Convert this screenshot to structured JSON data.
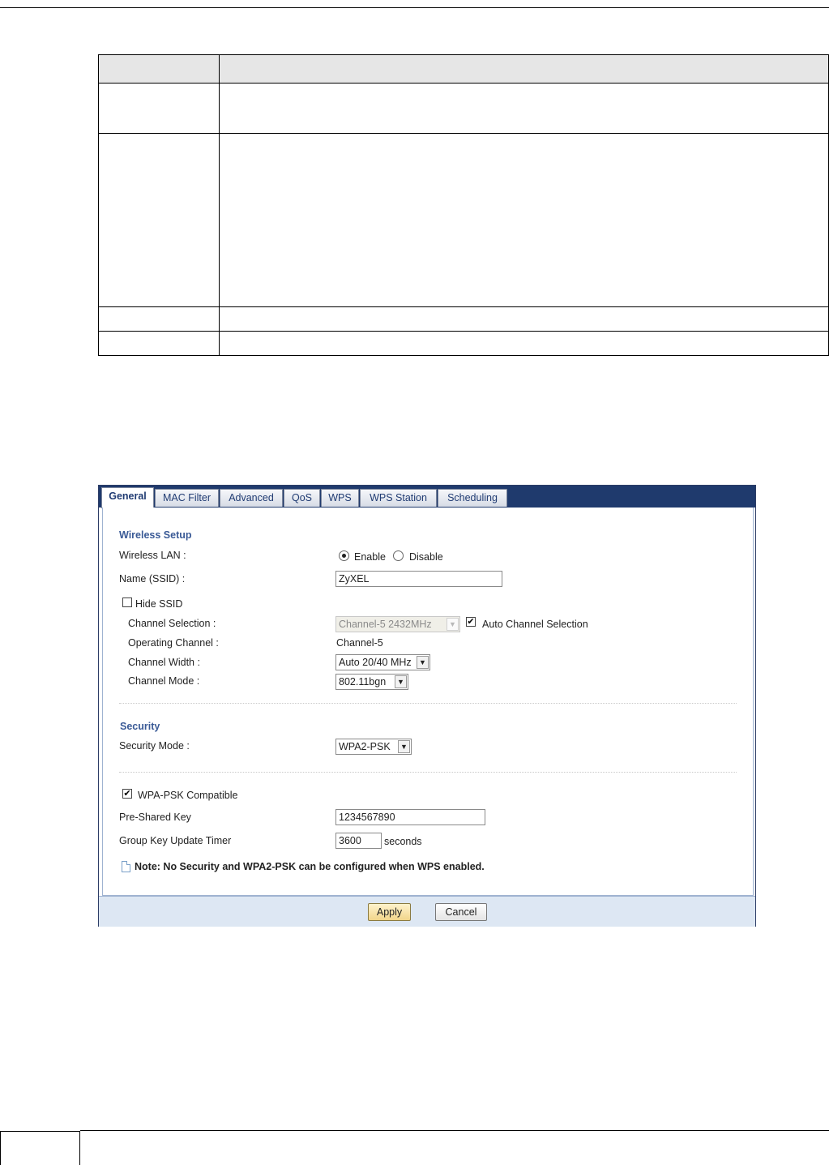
{
  "tabs": [
    {
      "label": "General",
      "active": true
    },
    {
      "label": "MAC Filter",
      "active": false
    },
    {
      "label": "Advanced",
      "active": false
    },
    {
      "label": "QoS",
      "active": false
    },
    {
      "label": "WPS",
      "active": false
    },
    {
      "label": "WPS Station",
      "active": false
    },
    {
      "label": "Scheduling",
      "active": false
    }
  ],
  "wireless_setup": {
    "title": "Wireless Setup",
    "wireless_lan_label": "Wireless LAN :",
    "enable_label": "Enable",
    "disable_label": "Disable",
    "wireless_lan_value": "Enable",
    "ssid_label": "Name (SSID) :",
    "ssid_value": "ZyXEL",
    "hide_ssid_label": "Hide SSID",
    "hide_ssid_checked": false,
    "channel_selection_label": "Channel Selection :",
    "channel_selection_value": "Channel-5 2432MHz",
    "auto_channel_label": "Auto Channel Selection",
    "auto_channel_checked": true,
    "operating_channel_label": "Operating Channel :",
    "operating_channel_value": "Channel-5",
    "channel_width_label": "Channel Width :",
    "channel_width_value": "Auto 20/40 MHz",
    "channel_mode_label": "Channel Mode :",
    "channel_mode_value": "802.11bgn"
  },
  "security": {
    "title": "Security",
    "mode_label": "Security Mode :",
    "mode_value": "WPA2-PSK",
    "wpa_psk_compat_label": "WPA-PSK Compatible",
    "wpa_psk_compat_checked": true,
    "psk_label": "Pre-Shared Key",
    "psk_value": "1234567890",
    "group_key_label": "Group Key Update Timer",
    "group_key_value": "3600",
    "group_key_unit": "seconds"
  },
  "note": "Note: No Security and WPA2-PSK can be configured when WPS enabled.",
  "footer": {
    "apply_label": "Apply",
    "cancel_label": "Cancel"
  },
  "icons": {
    "check": "✔",
    "arrow": "▼"
  },
  "colors": {
    "tabbar": "#1f3a6d",
    "section_title": "#3a5a96",
    "footer_bg": "#dde7f3"
  }
}
